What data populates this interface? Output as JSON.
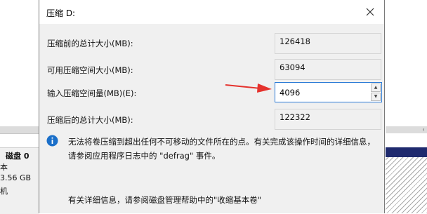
{
  "background": {
    "disk": {
      "name": "磁盘 0",
      "type_fragment": "本",
      "size_fragment": "3.56 GB",
      "status_fragment": "机"
    },
    "scroll_arrow": "‹"
  },
  "dialog": {
    "title": "压缩 D:",
    "close_icon": "close-icon",
    "rows": [
      {
        "label": "压缩前的总计大小(MB):",
        "value": "126418"
      },
      {
        "label": "可用压缩空间大小(MB):",
        "value": "63094"
      },
      {
        "label": "输入压缩空间量(MB)(E):",
        "value": "4096"
      },
      {
        "label": "压缩后的总计大小(MB):",
        "value": "122322"
      }
    ],
    "spinner": {
      "up": "▲",
      "down": "▼"
    },
    "info_text": "无法将卷压缩到超出任何不可移动的文件所在的点。有关完成该操作时间的详细信息，请参阅应用程序日志中的 \"defrag\" 事件。",
    "help_text": "有关详细信息，请参阅磁盘管理帮助中的\"收缩基本卷\"",
    "accent_color": "#2a7ad6",
    "arrow_color": "#e5322d",
    "info_icon_color": "#1a6fc9"
  }
}
